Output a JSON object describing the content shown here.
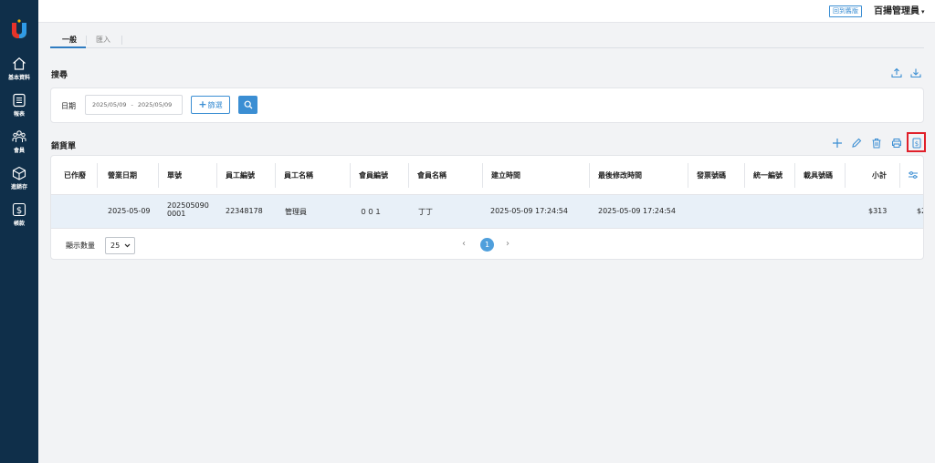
{
  "sidebar": {
    "items": [
      {
        "label": "基本資料",
        "icon": "home-icon"
      },
      {
        "label": "報表",
        "icon": "report-icon"
      },
      {
        "label": "會員",
        "icon": "members-icon"
      },
      {
        "label": "進銷存",
        "icon": "inventory-box-icon"
      },
      {
        "label": "帳款",
        "icon": "dollar-icon"
      }
    ]
  },
  "header": {
    "old_version_label": "回到舊版",
    "user_name": "百揚管理員",
    "user_caret": "▾"
  },
  "tabs": [
    {
      "label": "一般",
      "active": true
    },
    {
      "label": "匯入",
      "active": false
    }
  ],
  "search": {
    "title": "搜尋",
    "date_label": "日期",
    "date_start": "2025/05/09",
    "date_sep": "-",
    "date_end": "2025/05/09",
    "filter_label": "篩選",
    "filter_plus": "+"
  },
  "sales": {
    "title": "銷貨單",
    "columns": [
      "已作廢",
      "營業日期",
      "單號",
      "員工編號",
      "員工名稱",
      "會員編號",
      "會員名稱",
      "建立時間",
      "最後修改時間",
      "發票號碼",
      "統一編號",
      "載具號碼",
      "小計"
    ],
    "rows": [
      {
        "voided": "",
        "business_date": "2025-05-09",
        "order_no_line1": "202505090",
        "order_no_line2": "0001",
        "employee_id": "22348178",
        "employee_name": "管理員",
        "member_id": "００１",
        "member_name": "丁丁",
        "created_at": "2025-05-09 17:24:54",
        "updated_at": "2025-05-09 17:24:54",
        "invoice_no": "",
        "tax_id": "",
        "carrier_no": "",
        "subtotal": "$313",
        "overflow_value": "$2"
      }
    ]
  },
  "pagination": {
    "page_size_label": "顯示數量",
    "page_size": "25",
    "prev": "‹",
    "current_page": "1",
    "next": "›"
  },
  "colors": {
    "sidebar": "#0f2f4a",
    "accent": "#3b8ed3",
    "highlight": "#e0202a",
    "row_selected": "#e8f0f8"
  }
}
